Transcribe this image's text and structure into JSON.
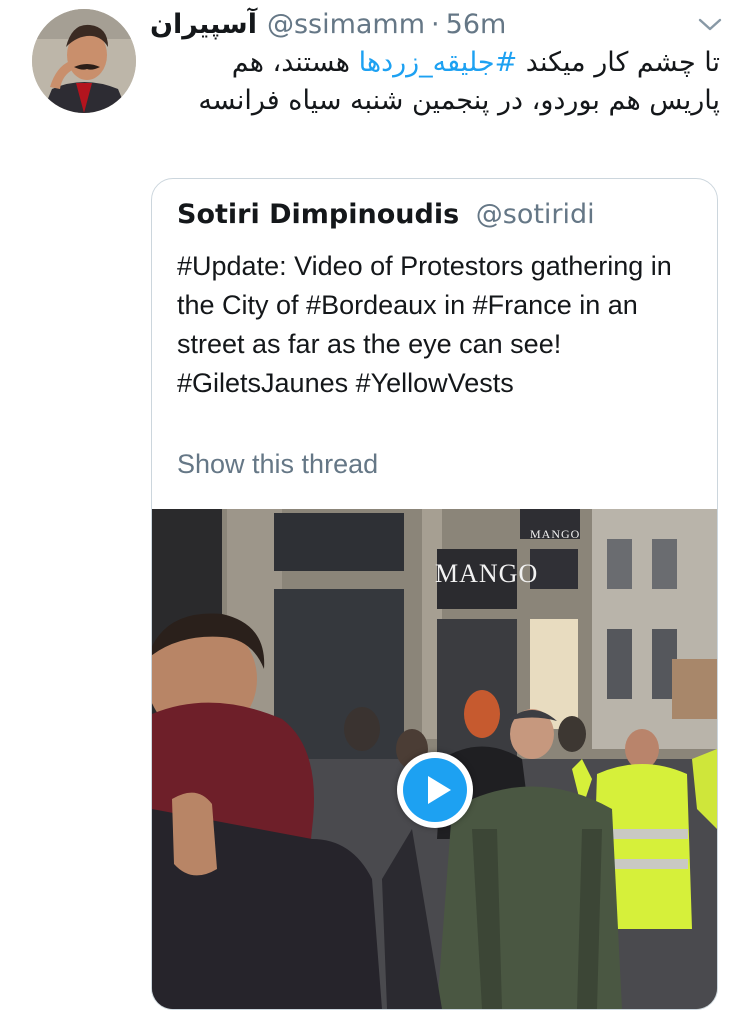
{
  "tweet": {
    "display_name": "آسپیران",
    "handle": "@ssimamm",
    "separator": "·",
    "time": "56m",
    "text_part1": "تا چشم کار میکند ",
    "hashtag": "#جلیقه_زردها",
    "text_part2": " هستند، هم پاریس هم بوردو، در پنجمین شنبه سیاه فرانسه"
  },
  "quoted_tweet": {
    "display_name": "Sotiri Dimpinoudis",
    "handle": "@sotiridi",
    "text": "#Update: Video of Protestors gathering in the City of #Bordeaux in #France in an street as far as the eye can see! #GiletsJaunes #YellowVests",
    "show_thread": "Show this thread",
    "media": {
      "store_sign_1": "MANGO",
      "store_sign_2": "MANGO"
    }
  },
  "colors": {
    "accent": "#1da1f2",
    "secondary_text": "#657786",
    "border": "#ccd6dd",
    "vest": "#d6f03a"
  },
  "icons": {
    "caret": "chevron-down-icon",
    "play": "play-icon"
  }
}
